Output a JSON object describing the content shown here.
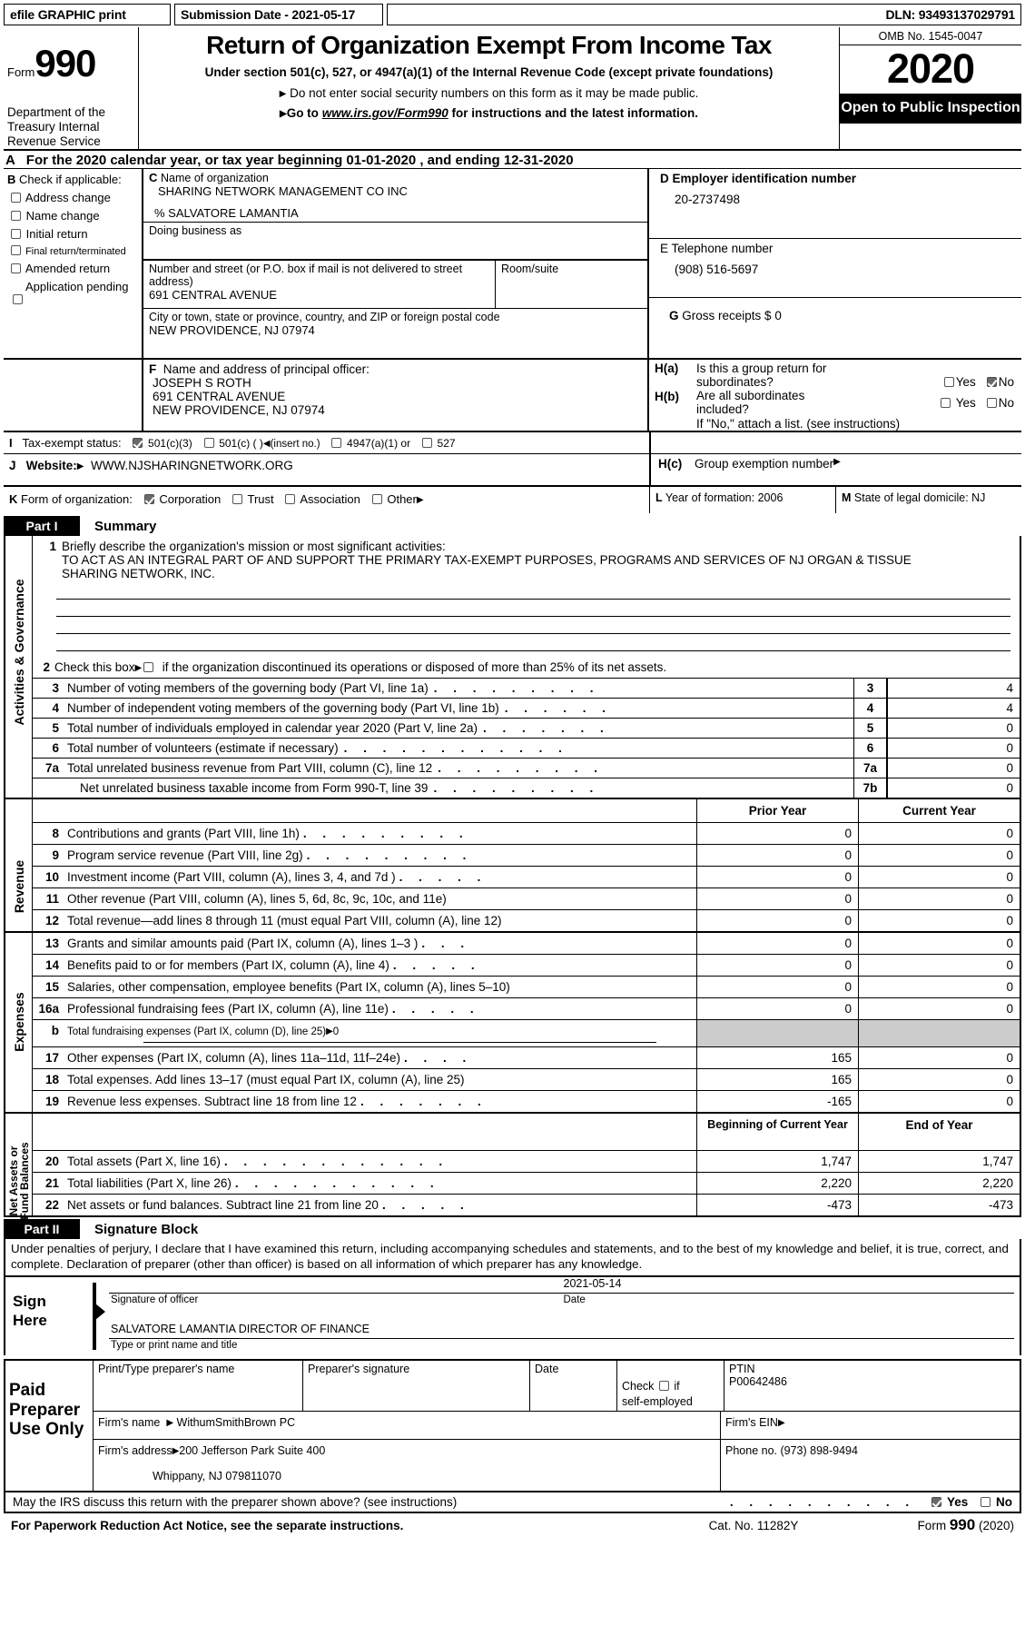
{
  "banner": {
    "efile_label": "efile GRAPHIC print",
    "submission_date": "Submission Date - 2021-05-17",
    "dln": "DLN: 93493137029791"
  },
  "masthead": {
    "form_word": "Form",
    "form_number": "990",
    "dept_line": "Department of the Treasury Internal Revenue Service",
    "title": "Return of Organization Exempt From Income Tax",
    "subtitle1": "Under section 501(c), 527, or 4947(a)(1) of the Internal Revenue Code (except private foundations)",
    "subtitle2": "Do not enter social security numbers on this form as it may be made public.",
    "subtitle3_pre": "Go to ",
    "subtitle3_link": "www.irs.gov/Form990",
    "subtitle3_post": " for instructions and the latest information.",
    "omb": "OMB No. 1545-0047",
    "tax_year": "2020",
    "open_to_public": "Open to Public Inspection"
  },
  "line_a": {
    "letter": "A",
    "text": "For the 2020 calendar year, or tax year beginning 01-01-2020   , and ending 12-31-2020"
  },
  "section_b": {
    "letter": "B",
    "heading": "Check if applicable:",
    "items": [
      {
        "label": "Address change",
        "checked": false
      },
      {
        "label": "Name change",
        "checked": false
      },
      {
        "label": "Initial return",
        "checked": false
      },
      {
        "label": "Final return/terminated",
        "checked": false
      },
      {
        "label": "Amended return",
        "checked": false
      },
      {
        "label": "Application pending",
        "checked": false
      }
    ]
  },
  "section_c": {
    "letter": "C",
    "name_label": "Name of organization",
    "org_name": "SHARING NETWORK MANAGEMENT CO INC",
    "care_of": "% SALVATORE LAMANTIA",
    "dba_label": "Doing business as",
    "dba_value": "",
    "street_label": "Number and street (or P.O. box if mail is not delivered to street address)",
    "street_value": "691 CENTRAL AVENUE",
    "room_label": "Room/suite",
    "room_value": "",
    "city_label": "City or town, state or province, country, and ZIP or foreign postal code",
    "city_value": "NEW PROVIDENCE, NJ  07974"
  },
  "section_d": {
    "letter": "D",
    "label": "Employer identification number",
    "value": "20-2737498"
  },
  "section_e": {
    "letter": "E",
    "label": "Telephone number",
    "value": "(908) 516-5697"
  },
  "section_g": {
    "letter": "G",
    "label": "Gross receipts $ 0"
  },
  "section_f": {
    "letter": "F",
    "label": "Name and address of principal officer:",
    "lines": [
      "JOSEPH S ROTH",
      "691 CENTRAL AVENUE",
      "NEW PROVIDENCE, NJ  07974"
    ]
  },
  "section_h": {
    "a_label": "H(a)",
    "a_text": "Is this a group return for subordinates?",
    "a_yes": "Yes",
    "a_no": "No",
    "a_yes_checked": false,
    "a_no_checked": true,
    "b_label": "H(b)",
    "b_text": "Are all subordinates included?",
    "b_yes": "Yes",
    "b_no": "No",
    "b_yes_checked": false,
    "b_no_checked": false,
    "b_note": "If \"No,\" attach a list. (see instructions)",
    "c_label": "H(c)",
    "c_text": "Group exemption number"
  },
  "section_i": {
    "letter": "I",
    "label": "Tax-exempt status:",
    "options": [
      {
        "label": "501(c)(3)",
        "checked": true
      },
      {
        "label": "501(c) (  )",
        "checked": false,
        "suffix": "(insert no.)"
      },
      {
        "label": "4947(a)(1) or",
        "checked": false
      },
      {
        "label": "527",
        "checked": false
      }
    ]
  },
  "section_j": {
    "letter": "J",
    "label": "Website:",
    "value": "WWW.NJSHARINGNETWORK.ORG"
  },
  "section_k": {
    "letter": "K",
    "label": "Form of organization:",
    "options": [
      {
        "label": "Corporation",
        "checked": true
      },
      {
        "label": "Trust",
        "checked": false
      },
      {
        "label": "Association",
        "checked": false
      },
      {
        "label": "Other",
        "checked": false
      }
    ]
  },
  "section_l": {
    "letter": "L",
    "label": "Year of formation:",
    "value": "2006"
  },
  "section_m": {
    "letter": "M",
    "label": "State of legal domicile:",
    "value": "NJ"
  },
  "part1": {
    "part_label": "Part I",
    "part_title": "Summary",
    "vertical_labels": {
      "activities": "Activities & Governance",
      "revenue": "Revenue",
      "expenses": "Expenses",
      "netassets": "Net Assets or Fund Balances"
    },
    "line1": {
      "no": "1",
      "prompt": "Briefly describe the organization's mission or most significant activities:",
      "text_line1": "TO ACT AS AN INTEGRAL PART OF AND SUPPORT THE PRIMARY TAX-EXEMPT PURPOSES, PROGRAMS AND SERVICES OF NJ ORGAN & TISSUE",
      "text_line2": "SHARING NETWORK, INC."
    },
    "line2": {
      "no": "2",
      "pre": "Check this box",
      "post": "if the organization discontinued its operations or disposed of more than 25% of its net assets.",
      "checked": false
    },
    "gov_rows": [
      {
        "no": "3",
        "text": "Number of voting members of the governing body (Part VI, line 1a)",
        "box": "3",
        "value": "4"
      },
      {
        "no": "4",
        "text": "Number of independent voting members of the governing body (Part VI, line 1b)",
        "box": "4",
        "value": "4"
      },
      {
        "no": "5",
        "text": "Total number of individuals employed in calendar year 2020 (Part V, line 2a)",
        "box": "5",
        "value": "0"
      },
      {
        "no": "6",
        "text": "Total number of volunteers (estimate if necessary)",
        "box": "6",
        "value": "0"
      },
      {
        "no": "7a",
        "text": "Total unrelated business revenue from Part VIII, column (C), line 12",
        "box": "7a",
        "value": "0"
      },
      {
        "no": "",
        "text": "Net unrelated business taxable income from Form 990-T, line 39",
        "box": "7b",
        "value": "0"
      }
    ],
    "money_headers_1": {
      "prior": "Prior Year",
      "current": "Current Year"
    },
    "revenue_rows": [
      {
        "no": "8",
        "text": "Contributions and grants (Part VIII, line 1h)",
        "prior": "0",
        "current": "0"
      },
      {
        "no": "9",
        "text": "Program service revenue (Part VIII, line 2g)",
        "prior": "0",
        "current": "0"
      },
      {
        "no": "10",
        "text": "Investment income (Part VIII, column (A), lines 3, 4, and 7d )",
        "prior": "0",
        "current": "0"
      },
      {
        "no": "11",
        "text": "Other revenue (Part VIII, column (A), lines 5, 6d, 8c, 9c, 10c, and 11e)",
        "prior": "0",
        "current": "0"
      },
      {
        "no": "12",
        "text": "Total revenue—add lines 8 through 11 (must equal Part VIII, column (A), line 12)",
        "prior": "0",
        "current": "0"
      }
    ],
    "expense_rows": [
      {
        "no": "13",
        "text": "Grants and similar amounts paid (Part IX, column (A), lines 1–3 )",
        "prior": "0",
        "current": "0"
      },
      {
        "no": "14",
        "text": "Benefits paid to or for members (Part IX, column (A), line 4)",
        "prior": "0",
        "current": "0"
      },
      {
        "no": "15",
        "text": "Salaries, other compensation, employee benefits (Part IX, column (A), lines 5–10)",
        "prior": "0",
        "current": "0"
      },
      {
        "no": "16a",
        "text": "Professional fundraising fees (Part IX, column (A), line 11e)",
        "prior": "0",
        "current": "0"
      },
      {
        "no": "b",
        "text": "Total fundraising expenses (Part IX, column (D), line 25)",
        "value_inline": "0",
        "prior": "",
        "current": "",
        "shaded": true
      },
      {
        "no": "17",
        "text": "Other expenses (Part IX, column (A), lines 11a–11d, 11f–24e)",
        "prior": "165",
        "current": "0"
      },
      {
        "no": "18",
        "text": "Total expenses. Add lines 13–17 (must equal Part IX, column (A), line 25)",
        "prior": "165",
        "current": "0"
      },
      {
        "no": "19",
        "text": "Revenue less expenses. Subtract line 18 from line 12",
        "prior": "-165",
        "current": "0"
      }
    ],
    "money_headers_2": {
      "prior": "Beginning of Current Year",
      "current": "End of Year"
    },
    "balance_rows": [
      {
        "no": "20",
        "text": "Total assets (Part X, line 16)",
        "prior": "1,747",
        "current": "1,747"
      },
      {
        "no": "21",
        "text": "Total liabilities (Part X, line 26)",
        "prior": "2,220",
        "current": "2,220"
      },
      {
        "no": "22",
        "text": "Net assets or fund balances. Subtract line 21 from line 20",
        "prior": "-473",
        "current": "-473"
      }
    ]
  },
  "part2": {
    "part_label": "Part II",
    "part_title": "Signature Block",
    "perjury": "Under penalties of perjury, I declare that I have examined this return, including accompanying schedules and statements, and to the best of my knowledge and belief, it is true, correct, and complete. Declaration of preparer (other than officer) is based on all information of which preparer has any knowledge.",
    "sign_here": "Sign Here",
    "officer_signature_value": "",
    "officer_signature_caption": "Signature of officer",
    "officer_date_value": "2021-05-14",
    "officer_date_caption": "Date",
    "officer_name_value": "SALVATORE LAMANTIA  DIRECTOR OF FINANCE",
    "officer_name_caption": "Type or print name and title",
    "paid_preparer_label": "Paid Preparer Use Only",
    "preparer_headers": {
      "name": "Print/Type preparer's name",
      "signature": "Preparer's signature",
      "date": "Date",
      "check_self": "Check         if self-employed",
      "ptin": "PTIN"
    },
    "preparer_values": {
      "name": "",
      "signature": "",
      "date": "",
      "self_employed_checked": false,
      "ptin": "P00642486"
    },
    "firm_name_label": "Firm's name",
    "firm_name_value": "WithumSmithBrown PC",
    "firm_ein_label": "Firm's EIN",
    "firm_ein_value": "",
    "firm_address_label": "Firm's address",
    "firm_address_line1": "200 Jefferson Park Suite 400",
    "firm_address_line2": "Whippany, NJ  079811070",
    "firm_phone_label": "Phone no.",
    "firm_phone_value": "(973) 898-9494",
    "irs_discuss": "May the IRS discuss this return with the preparer shown above? (see instructions)",
    "irs_yes": "Yes",
    "irs_no": "No",
    "irs_yes_checked": true,
    "irs_no_checked": false
  },
  "footer": {
    "left": "For Paperwork Reduction Act Notice, see the separate instructions.",
    "cat": "Cat. No. 11282Y",
    "form_pre": "Form",
    "form_no": "990",
    "form_year": "(2020)"
  }
}
